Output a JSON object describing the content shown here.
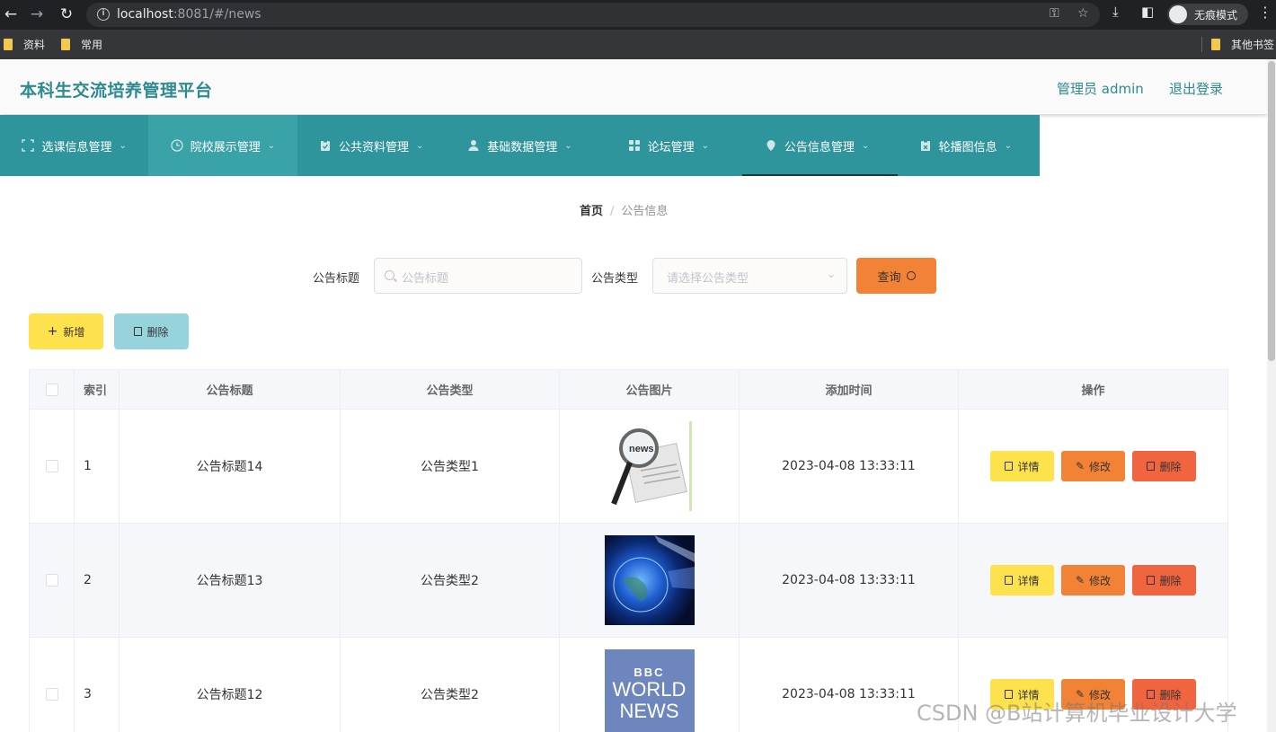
{
  "browser": {
    "url_host": "localhost",
    "url_rest": ":8081/#/news",
    "incognito_label": "无痕模式",
    "bookmarks": [
      "资料",
      "常用"
    ],
    "other_bookmarks": "其他书签"
  },
  "header": {
    "title": "本科生交流培养管理平台",
    "user": "管理员 admin",
    "logout": "退出登录"
  },
  "menu": [
    {
      "label": "选课信息管理",
      "icon": "expand-icon"
    },
    {
      "label": "院校展示管理",
      "icon": "clock-icon"
    },
    {
      "label": "公共资料管理",
      "icon": "clipboard-icon"
    },
    {
      "label": "基础数据管理",
      "icon": "user-icon"
    },
    {
      "label": "论坛管理",
      "icon": "grid-icon"
    },
    {
      "label": "公告信息管理",
      "icon": "location-icon"
    },
    {
      "label": "轮播图信息",
      "icon": "clipboard-icon"
    }
  ],
  "breadcrumb": {
    "home": "首页",
    "separator": "/",
    "current": "公告信息"
  },
  "search": {
    "title_label": "公告标题",
    "title_placeholder": "公告标题",
    "type_label": "公告类型",
    "type_placeholder": "请选择公告类型",
    "query_button": "查询"
  },
  "actions": {
    "add": "新增",
    "delete": "删除"
  },
  "table": {
    "headers": [
      "索引",
      "公告标题",
      "公告类型",
      "公告图片",
      "添加时间",
      "操作"
    ],
    "rows": [
      {
        "index": "1",
        "title": "公告标题14",
        "type": "公告类型1",
        "image": "news-magnifier",
        "time": "2023-04-08 13:33:11"
      },
      {
        "index": "2",
        "title": "公告标题13",
        "type": "公告类型2",
        "image": "globe",
        "time": "2023-04-08 13:33:11"
      },
      {
        "index": "3",
        "title": "公告标题12",
        "type": "公告类型2",
        "image": "bbc-world-news",
        "time": "2023-04-08 13:33:11"
      }
    ],
    "op_labels": {
      "detail": "详情",
      "edit": "修改",
      "delete": "删除"
    }
  },
  "image_texts": {
    "news_mag": "news",
    "bbc_logo": "BBC",
    "bbc_line1": "WORLD",
    "bbc_line2": "NEWS"
  },
  "watermark": "CSDN @B站计算机毕业设计大学",
  "colors": {
    "teal": "#2d959b",
    "title_teal": "#2d8a8e",
    "yellow": "#fde14d",
    "orange": "#f28235",
    "red": "#f0643f",
    "light_blue": "#96d3dd"
  }
}
